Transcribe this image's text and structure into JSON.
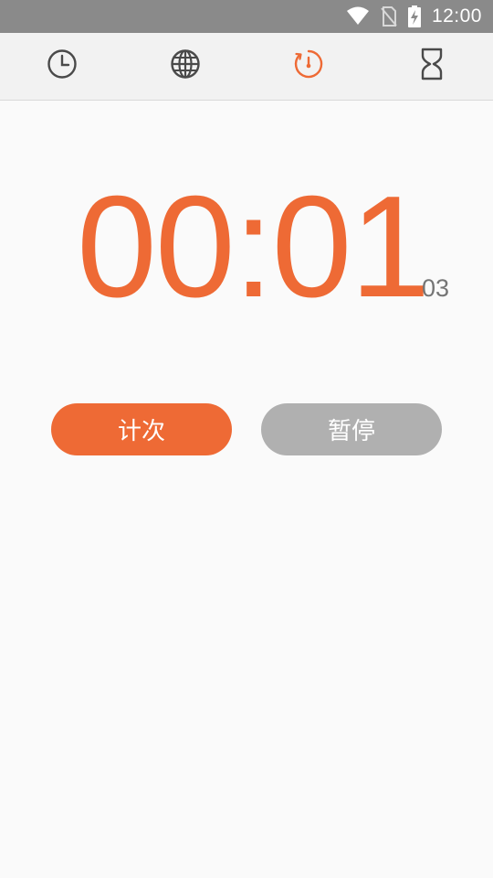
{
  "status_bar": {
    "time": "12:00",
    "icons": [
      "wifi-icon",
      "no-sim-icon",
      "battery-charging-icon"
    ]
  },
  "tabs": [
    {
      "name": "clock",
      "icon": "clock-icon",
      "active": false
    },
    {
      "name": "world-clock",
      "icon": "globe-icon",
      "active": false
    },
    {
      "name": "stopwatch",
      "icon": "stopwatch-icon",
      "active": true
    },
    {
      "name": "timer",
      "icon": "hourglass-icon",
      "active": false
    }
  ],
  "stopwatch": {
    "elapsed": "00:01",
    "centiseconds": "03"
  },
  "buttons": {
    "lap_label": "计次",
    "pause_label": "暂停"
  },
  "colors": {
    "accent": "#ee6a35",
    "icon_default": "#4a4a4a",
    "pause_button": "#b0b0b0",
    "status_bar": "#8a8a8a",
    "background": "#fafafa"
  }
}
